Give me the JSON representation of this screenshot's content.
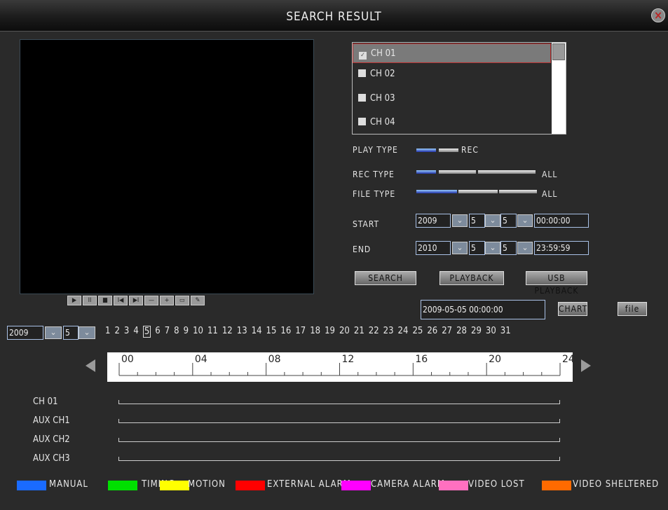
{
  "window": {
    "title": "SEARCH RESULT",
    "close_icon": "close-icon"
  },
  "playback_controls": [
    {
      "name": "play-icon",
      "glyph": "▶"
    },
    {
      "name": "pause-icon",
      "glyph": "II"
    },
    {
      "name": "stop-icon",
      "glyph": "■"
    },
    {
      "name": "prev-icon",
      "glyph": "I◀"
    },
    {
      "name": "next-icon",
      "glyph": "▶I"
    },
    {
      "name": "minus-icon",
      "glyph": "—"
    },
    {
      "name": "plus-icon",
      "glyph": "+"
    },
    {
      "name": "fullscreen-icon",
      "glyph": "▭"
    },
    {
      "name": "edit-icon",
      "glyph": "✎"
    }
  ],
  "channels": [
    {
      "label": "CH 01",
      "checked": true
    },
    {
      "label": "CH 02",
      "checked": false
    },
    {
      "label": "CH 03",
      "checked": false
    },
    {
      "label": "CH 04",
      "checked": false
    }
  ],
  "play_type": {
    "label": "PLAY TYPE",
    "value": "REC"
  },
  "rec_type": {
    "label": "REC TYPE",
    "value": "ALL"
  },
  "file_type": {
    "label": "FILE TYPE",
    "value": "ALL"
  },
  "start": {
    "label": "START",
    "year": "2009",
    "month": "5",
    "day": "5",
    "time": "00:00:00"
  },
  "end": {
    "label": "END",
    "year": "2010",
    "month": "5",
    "day": "5",
    "time": "23:59:59"
  },
  "buttons": {
    "search": "SEARCH",
    "playback": "PLAYBACK",
    "usb_playback": "USB PLAYBACK",
    "chart": "CHART",
    "file": "file"
  },
  "current_time": "2009-05-05  00:00:00",
  "calendar": {
    "year": "2009",
    "month": "5",
    "selected_day": 5,
    "days": [
      "1",
      "2",
      "3",
      "4",
      "5",
      "6",
      "7",
      "8",
      "9",
      "10",
      "11",
      "12",
      "13",
      "14",
      "15",
      "16",
      "17",
      "18",
      "19",
      "20",
      "21",
      "22",
      "23",
      "24",
      "25",
      "26",
      "27",
      "28",
      "29",
      "30",
      "31"
    ]
  },
  "timeline": {
    "hour_labels": [
      "00",
      "04",
      "08",
      "12",
      "16",
      "20",
      "24"
    ]
  },
  "timeline_channels": [
    "CH 01",
    "AUX CH1",
    "AUX CH2",
    "AUX CH3"
  ],
  "legend": [
    {
      "label": "MANUAL",
      "color": "#1a6bff"
    },
    {
      "label": "TIMING",
      "color": "#00e000"
    },
    {
      "label": "MOTION",
      "color": "#ffff00"
    },
    {
      "label": "EXTERNAL ALARM",
      "color": "#ff0000"
    },
    {
      "label": "CAMERA ALARM",
      "color": "#ff00ff"
    },
    {
      "label": "VIDEO LOST",
      "color": "#ff70c0"
    },
    {
      "label": "VIDEO SHELTERED",
      "color": "#ff6a00"
    }
  ]
}
